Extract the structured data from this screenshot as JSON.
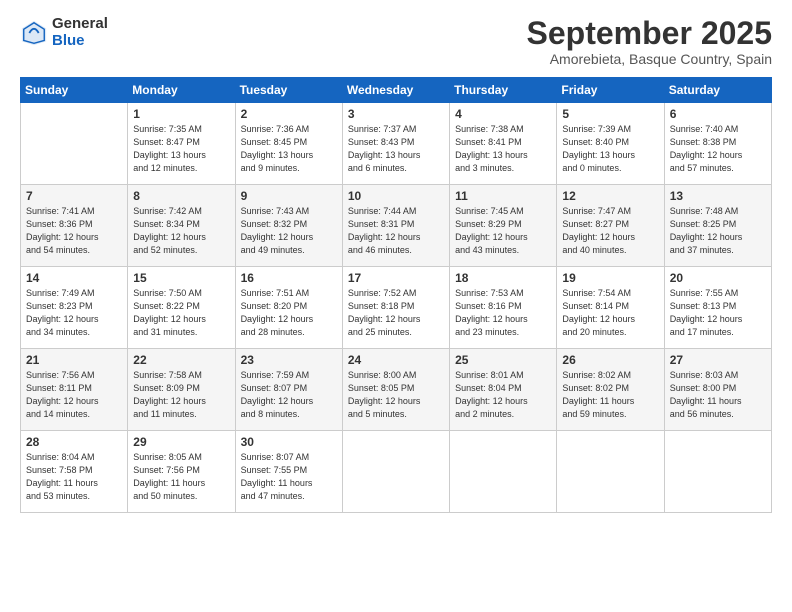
{
  "logo": {
    "general": "General",
    "blue": "Blue"
  },
  "title": "September 2025",
  "location": "Amorebieta, Basque Country, Spain",
  "weekdays": [
    "Sunday",
    "Monday",
    "Tuesday",
    "Wednesday",
    "Thursday",
    "Friday",
    "Saturday"
  ],
  "weeks": [
    [
      {
        "day": "",
        "sunrise": "",
        "sunset": "",
        "daylight": ""
      },
      {
        "day": "1",
        "sunrise": "Sunrise: 7:35 AM",
        "sunset": "Sunset: 8:47 PM",
        "daylight": "Daylight: 13 hours and 12 minutes."
      },
      {
        "day": "2",
        "sunrise": "Sunrise: 7:36 AM",
        "sunset": "Sunset: 8:45 PM",
        "daylight": "Daylight: 13 hours and 9 minutes."
      },
      {
        "day": "3",
        "sunrise": "Sunrise: 7:37 AM",
        "sunset": "Sunset: 8:43 PM",
        "daylight": "Daylight: 13 hours and 6 minutes."
      },
      {
        "day": "4",
        "sunrise": "Sunrise: 7:38 AM",
        "sunset": "Sunset: 8:41 PM",
        "daylight": "Daylight: 13 hours and 3 minutes."
      },
      {
        "day": "5",
        "sunrise": "Sunrise: 7:39 AM",
        "sunset": "Sunset: 8:40 PM",
        "daylight": "Daylight: 13 hours and 0 minutes."
      },
      {
        "day": "6",
        "sunrise": "Sunrise: 7:40 AM",
        "sunset": "Sunset: 8:38 PM",
        "daylight": "Daylight: 12 hours and 57 minutes."
      }
    ],
    [
      {
        "day": "7",
        "sunrise": "Sunrise: 7:41 AM",
        "sunset": "Sunset: 8:36 PM",
        "daylight": "Daylight: 12 hours and 54 minutes."
      },
      {
        "day": "8",
        "sunrise": "Sunrise: 7:42 AM",
        "sunset": "Sunset: 8:34 PM",
        "daylight": "Daylight: 12 hours and 52 minutes."
      },
      {
        "day": "9",
        "sunrise": "Sunrise: 7:43 AM",
        "sunset": "Sunset: 8:32 PM",
        "daylight": "Daylight: 12 hours and 49 minutes."
      },
      {
        "day": "10",
        "sunrise": "Sunrise: 7:44 AM",
        "sunset": "Sunset: 8:31 PM",
        "daylight": "Daylight: 12 hours and 46 minutes."
      },
      {
        "day": "11",
        "sunrise": "Sunrise: 7:45 AM",
        "sunset": "Sunset: 8:29 PM",
        "daylight": "Daylight: 12 hours and 43 minutes."
      },
      {
        "day": "12",
        "sunrise": "Sunrise: 7:47 AM",
        "sunset": "Sunset: 8:27 PM",
        "daylight": "Daylight: 12 hours and 40 minutes."
      },
      {
        "day": "13",
        "sunrise": "Sunrise: 7:48 AM",
        "sunset": "Sunset: 8:25 PM",
        "daylight": "Daylight: 12 hours and 37 minutes."
      }
    ],
    [
      {
        "day": "14",
        "sunrise": "Sunrise: 7:49 AM",
        "sunset": "Sunset: 8:23 PM",
        "daylight": "Daylight: 12 hours and 34 minutes."
      },
      {
        "day": "15",
        "sunrise": "Sunrise: 7:50 AM",
        "sunset": "Sunset: 8:22 PM",
        "daylight": "Daylight: 12 hours and 31 minutes."
      },
      {
        "day": "16",
        "sunrise": "Sunrise: 7:51 AM",
        "sunset": "Sunset: 8:20 PM",
        "daylight": "Daylight: 12 hours and 28 minutes."
      },
      {
        "day": "17",
        "sunrise": "Sunrise: 7:52 AM",
        "sunset": "Sunset: 8:18 PM",
        "daylight": "Daylight: 12 hours and 25 minutes."
      },
      {
        "day": "18",
        "sunrise": "Sunrise: 7:53 AM",
        "sunset": "Sunset: 8:16 PM",
        "daylight": "Daylight: 12 hours and 23 minutes."
      },
      {
        "day": "19",
        "sunrise": "Sunrise: 7:54 AM",
        "sunset": "Sunset: 8:14 PM",
        "daylight": "Daylight: 12 hours and 20 minutes."
      },
      {
        "day": "20",
        "sunrise": "Sunrise: 7:55 AM",
        "sunset": "Sunset: 8:13 PM",
        "daylight": "Daylight: 12 hours and 17 minutes."
      }
    ],
    [
      {
        "day": "21",
        "sunrise": "Sunrise: 7:56 AM",
        "sunset": "Sunset: 8:11 PM",
        "daylight": "Daylight: 12 hours and 14 minutes."
      },
      {
        "day": "22",
        "sunrise": "Sunrise: 7:58 AM",
        "sunset": "Sunset: 8:09 PM",
        "daylight": "Daylight: 12 hours and 11 minutes."
      },
      {
        "day": "23",
        "sunrise": "Sunrise: 7:59 AM",
        "sunset": "Sunset: 8:07 PM",
        "daylight": "Daylight: 12 hours and 8 minutes."
      },
      {
        "day": "24",
        "sunrise": "Sunrise: 8:00 AM",
        "sunset": "Sunset: 8:05 PM",
        "daylight": "Daylight: 12 hours and 5 minutes."
      },
      {
        "day": "25",
        "sunrise": "Sunrise: 8:01 AM",
        "sunset": "Sunset: 8:04 PM",
        "daylight": "Daylight: 12 hours and 2 minutes."
      },
      {
        "day": "26",
        "sunrise": "Sunrise: 8:02 AM",
        "sunset": "Sunset: 8:02 PM",
        "daylight": "Daylight: 11 hours and 59 minutes."
      },
      {
        "day": "27",
        "sunrise": "Sunrise: 8:03 AM",
        "sunset": "Sunset: 8:00 PM",
        "daylight": "Daylight: 11 hours and 56 minutes."
      }
    ],
    [
      {
        "day": "28",
        "sunrise": "Sunrise: 8:04 AM",
        "sunset": "Sunset: 7:58 PM",
        "daylight": "Daylight: 11 hours and 53 minutes."
      },
      {
        "day": "29",
        "sunrise": "Sunrise: 8:05 AM",
        "sunset": "Sunset: 7:56 PM",
        "daylight": "Daylight: 11 hours and 50 minutes."
      },
      {
        "day": "30",
        "sunrise": "Sunrise: 8:07 AM",
        "sunset": "Sunset: 7:55 PM",
        "daylight": "Daylight: 11 hours and 47 minutes."
      },
      {
        "day": "",
        "sunrise": "",
        "sunset": "",
        "daylight": ""
      },
      {
        "day": "",
        "sunrise": "",
        "sunset": "",
        "daylight": ""
      },
      {
        "day": "",
        "sunrise": "",
        "sunset": "",
        "daylight": ""
      },
      {
        "day": "",
        "sunrise": "",
        "sunset": "",
        "daylight": ""
      }
    ]
  ]
}
